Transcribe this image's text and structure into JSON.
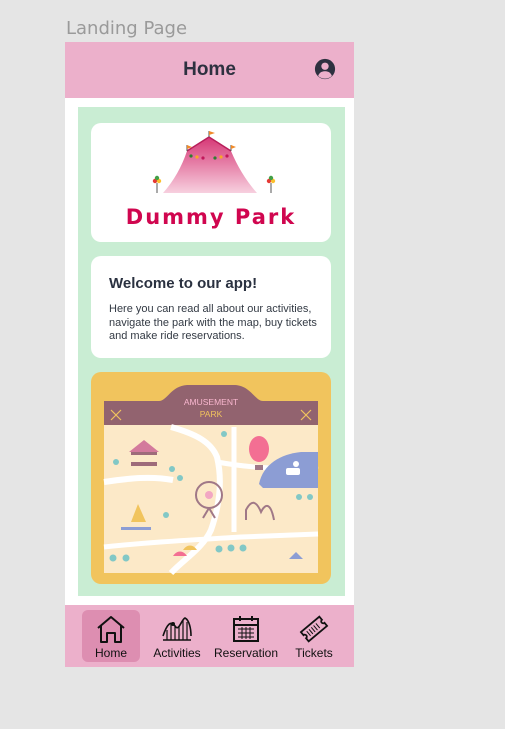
{
  "frame_label": "Landing Page",
  "header": {
    "title": "Home",
    "account_icon": "account-circle-icon"
  },
  "logo": {
    "brand": "Dummy Park",
    "icon": "circus-tent-icon"
  },
  "welcome": {
    "title": "Welcome to our app!",
    "text": "Here you can read all about our activities, navigate the park with the map, buy tickets and make ride reservations."
  },
  "map": {
    "title_line1": "AMUSEMENT",
    "title_line2": "PARK"
  },
  "nav": {
    "items": [
      {
        "label": "Home",
        "icon": "home-icon",
        "active": true
      },
      {
        "label": "Activities",
        "icon": "roller-coaster-icon",
        "active": false
      },
      {
        "label": "Reservation",
        "icon": "calendar-icon",
        "active": false
      },
      {
        "label": "Tickets",
        "icon": "ticket-icon",
        "active": false
      }
    ]
  },
  "colors": {
    "header_bg": "#ecb0cb",
    "content_bg": "#c9edd3",
    "brand": "#d0064f",
    "nav_active": "#dd8eb1",
    "map_frame": "#f1c45d"
  }
}
